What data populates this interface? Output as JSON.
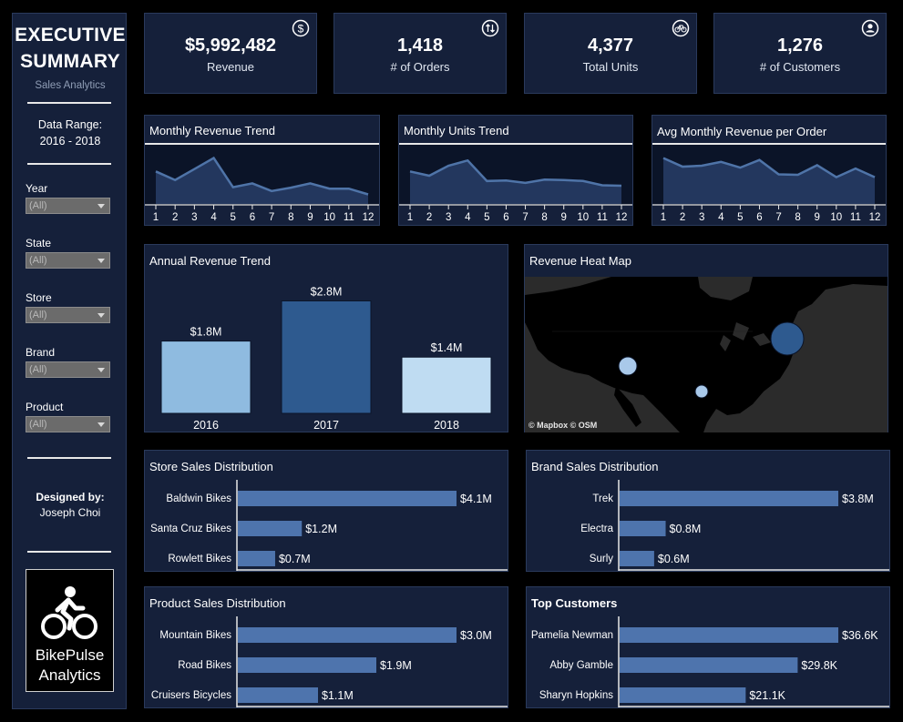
{
  "sidebar": {
    "title_line1": "EXECUTIVE",
    "title_line2": "SUMMARY",
    "subtitle": "Sales Analytics",
    "data_range_label": "Data Range:",
    "data_range_value": "2016 - 2018",
    "filters": [
      {
        "label": "Year",
        "value": "(All)"
      },
      {
        "label": "State",
        "value": "(All)"
      },
      {
        "label": "Store",
        "value": "(All)"
      },
      {
        "label": "Brand",
        "value": "(All)"
      },
      {
        "label": "Product",
        "value": "(All)"
      }
    ],
    "designed_by_label": "Designed by:",
    "designer": "Joseph Choi",
    "logo_line1": "BikePulse",
    "logo_line2": "Analytics",
    "logo_icon": "cyclist-icon"
  },
  "kpis": [
    {
      "value": "$5,992,482",
      "label": "Revenue",
      "icon": "dollar-icon"
    },
    {
      "value": "1,418",
      "label": "# of Orders",
      "icon": "sort-arrows-icon"
    },
    {
      "value": "4,377",
      "label": "Total Units",
      "icon": "bicycle-icon"
    },
    {
      "value": "1,276",
      "label": "# of Customers",
      "icon": "user-icon"
    }
  ],
  "colors": {
    "panel": "#15203a",
    "panel_dark": "#0b1428",
    "line": "#4f74a8",
    "area": "#23375e",
    "bar_store": "#4e74ad",
    "annual_2016": "#8fbbe0",
    "annual_2017": "#2e5a8f",
    "annual_2018": "#bfdcf2",
    "map_bg": "#2b2b2b",
    "map_land": "#000000",
    "map_point_light": "#a9c9ea",
    "map_point_dark": "#2e5a8f"
  },
  "chart_data": [
    {
      "type": "area",
      "title": "Monthly Revenue Trend",
      "categories": [
        "1",
        "2",
        "3",
        "4",
        "5",
        "6",
        "7",
        "8",
        "9",
        "10",
        "11",
        "12"
      ],
      "values": [
        0.68,
        0.5,
        0.73,
        0.96,
        0.35,
        0.43,
        0.27,
        0.34,
        0.43,
        0.32,
        0.32,
        0.2
      ],
      "ylim": [
        0,
        1.2
      ]
    },
    {
      "type": "area",
      "title": "Monthly Units Trend",
      "categories": [
        "1",
        "2",
        "3",
        "4",
        "5",
        "6",
        "7",
        "8",
        "9",
        "10",
        "11",
        "12"
      ],
      "values": [
        0.68,
        0.59,
        0.8,
        0.91,
        0.48,
        0.49,
        0.44,
        0.51,
        0.5,
        0.48,
        0.39,
        0.38
      ],
      "ylim": [
        0,
        1.2
      ]
    },
    {
      "type": "area",
      "title": "Avg Monthly Revenue per Order",
      "categories": [
        "1",
        "2",
        "3",
        "4",
        "5",
        "6",
        "7",
        "8",
        "9",
        "10",
        "11",
        "12"
      ],
      "values": [
        0.96,
        0.78,
        0.8,
        0.88,
        0.76,
        0.92,
        0.62,
        0.61,
        0.81,
        0.56,
        0.74,
        0.56
      ],
      "ylim": [
        0,
        1.2
      ]
    },
    {
      "type": "bar",
      "title": "Annual Revenue Trend",
      "categories": [
        "2016",
        "2017",
        "2018"
      ],
      "values": [
        1.8,
        2.8,
        1.4
      ],
      "data_labels": [
        "$1.8M",
        "$2.8M",
        "$1.4M"
      ],
      "ylim": [
        0,
        3.4
      ]
    },
    {
      "type": "bar",
      "orientation": "horizontal",
      "title": "Store Sales Distribution",
      "categories": [
        "Baldwin Bikes",
        "Santa Cruz Bikes",
        "Rowlett Bikes"
      ],
      "values": [
        4.1,
        1.2,
        0.7
      ],
      "data_labels": [
        "$4.1M",
        "$1.2M",
        "$0.7M"
      ],
      "xlim": [
        0,
        4.1
      ]
    },
    {
      "type": "bar",
      "orientation": "horizontal",
      "title": "Brand Sales Distribution",
      "categories": [
        "Trek",
        "Electra",
        "Surly"
      ],
      "values": [
        3.8,
        0.8,
        0.6
      ],
      "data_labels": [
        "$3.8M",
        "$0.8M",
        "$0.6M"
      ],
      "xlim": [
        0,
        3.8
      ]
    },
    {
      "type": "bar",
      "orientation": "horizontal",
      "title": "Product Sales Distribution",
      "categories": [
        "Mountain Bikes",
        "Road Bikes",
        "Cruisers Bicycles"
      ],
      "values": [
        3.0,
        1.9,
        1.1
      ],
      "data_labels": [
        "$3.0M",
        "$1.9M",
        "$1.1M"
      ],
      "xlim": [
        0,
        3.0
      ]
    },
    {
      "type": "bar",
      "orientation": "horizontal",
      "title": "Top Customers",
      "categories": [
        "Pamelia Newman",
        "Abby Gamble",
        "Sharyn Hopkins"
      ],
      "values": [
        36.6,
        29.8,
        21.1
      ],
      "data_labels": [
        "$36.6K",
        "$29.8K",
        "$21.1K"
      ],
      "xlim": [
        0,
        36.6
      ]
    }
  ],
  "map": {
    "title": "Revenue Heat Map",
    "credit": "© Mapbox © OSM",
    "points": [
      {
        "state": "NY",
        "relative_size": "large",
        "color": "dark"
      },
      {
        "state": "CA",
        "relative_size": "small",
        "color": "light"
      },
      {
        "state": "TX",
        "relative_size": "tiny",
        "color": "light"
      }
    ]
  }
}
